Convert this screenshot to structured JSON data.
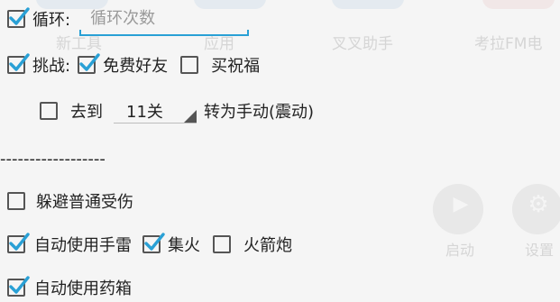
{
  "colors": {
    "check_blue": "#29a0d5",
    "input_underline": "#29a0d5"
  },
  "background_launcher": {
    "labels": [
      "新工具",
      "应用",
      "叉叉助手",
      "考拉FM电",
      "启动",
      "设置"
    ],
    "icons": [
      "play-icon",
      "gear-icon"
    ]
  },
  "loop": {
    "label": "循环:",
    "checked": true,
    "input_value": "",
    "input_placeholder": "循环次数"
  },
  "challenge": {
    "label": "挑战:",
    "checked": true,
    "free_friend": {
      "label": "免费好友",
      "checked": true
    },
    "buy_blessing": {
      "label": "买祝福",
      "checked": false
    }
  },
  "goto": {
    "checkbox_checked": false,
    "label": "去到",
    "level_value": "11关",
    "suffix": "转为手动(震动)"
  },
  "divider_text": "------------------",
  "dodge": {
    "label": "躲避普通受伤",
    "checked": false
  },
  "auto_grenade": {
    "label": "自动使用手雷",
    "checked": true
  },
  "focus_fire": {
    "label": "集火",
    "checked": true
  },
  "bazooka": {
    "label": "火箭炮",
    "checked": false
  },
  "auto_medkit": {
    "label": "自动使用药箱",
    "checked": true
  }
}
